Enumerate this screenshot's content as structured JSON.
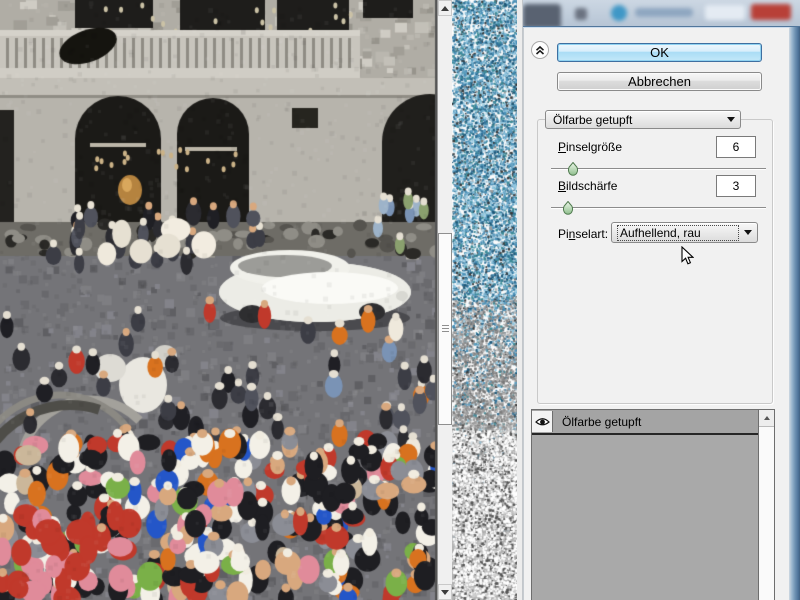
{
  "colors": {
    "panel_bg": "#f1f1f1",
    "ok_border": "#3f6fa0",
    "aero_mid": "#6f93b4",
    "list_bg": "#a9a9a9",
    "noise_blue": "#4a90b8"
  },
  "dialog": {
    "ok_label": "OK",
    "cancel_label": "Abbrechen",
    "filter_select": {
      "value": "Ölfarbe getupft"
    },
    "params": [
      {
        "label_mn": "P",
        "label_rest": "inselgröße",
        "value": "6",
        "thumb_percent": 10
      },
      {
        "label_mn": "B",
        "label_rest": "ildschärfe",
        "value": "3",
        "thumb_percent": 8
      }
    ],
    "brush_type": {
      "label_pre": "Pi",
      "label_mn": "n",
      "label_post": "selart:",
      "value": "Aufhellend, rau"
    },
    "effect_list": {
      "rows": [
        {
          "name": "Ölfarbe getupft",
          "visible": true
        }
      ]
    }
  }
}
